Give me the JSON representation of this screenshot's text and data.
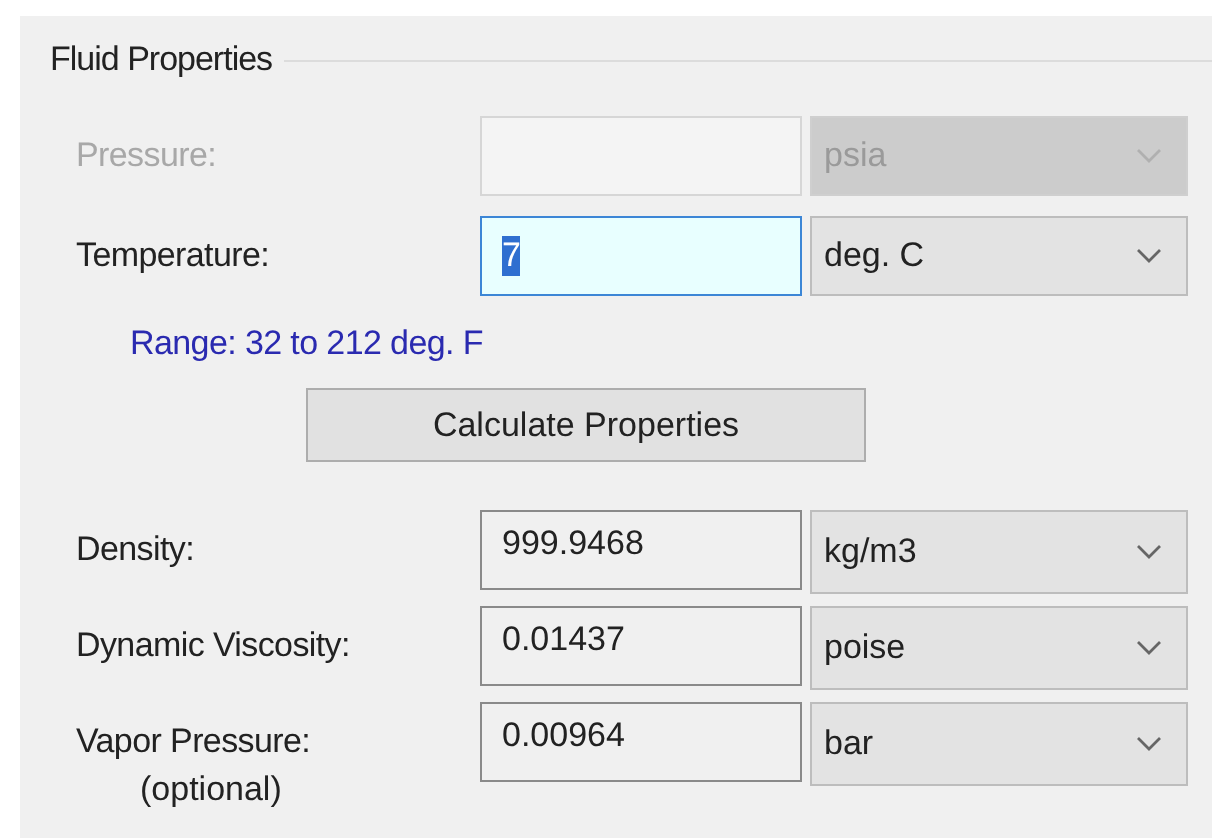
{
  "group": {
    "title": "Fluid Properties"
  },
  "inputs": [
    {
      "label": "Pressure:",
      "unit": "psia",
      "disabled": true,
      "focused": false
    },
    {
      "label": "Temperature:",
      "value": "7",
      "unit": "deg. C",
      "disabled": false,
      "focused": true
    }
  ],
  "range_hint": "Range: 32 to 212 deg. F",
  "calculate_button": "Calculate Properties",
  "results": [
    {
      "label": "Density:",
      "value": "999.9468",
      "unit": "kg/m3"
    },
    {
      "label": "Dynamic Viscosity:",
      "value": "0.01437",
      "unit": "poise"
    },
    {
      "label": "Vapor Pressure:",
      "note": "(optional)",
      "value": "0.00964",
      "unit": "bar"
    }
  ]
}
